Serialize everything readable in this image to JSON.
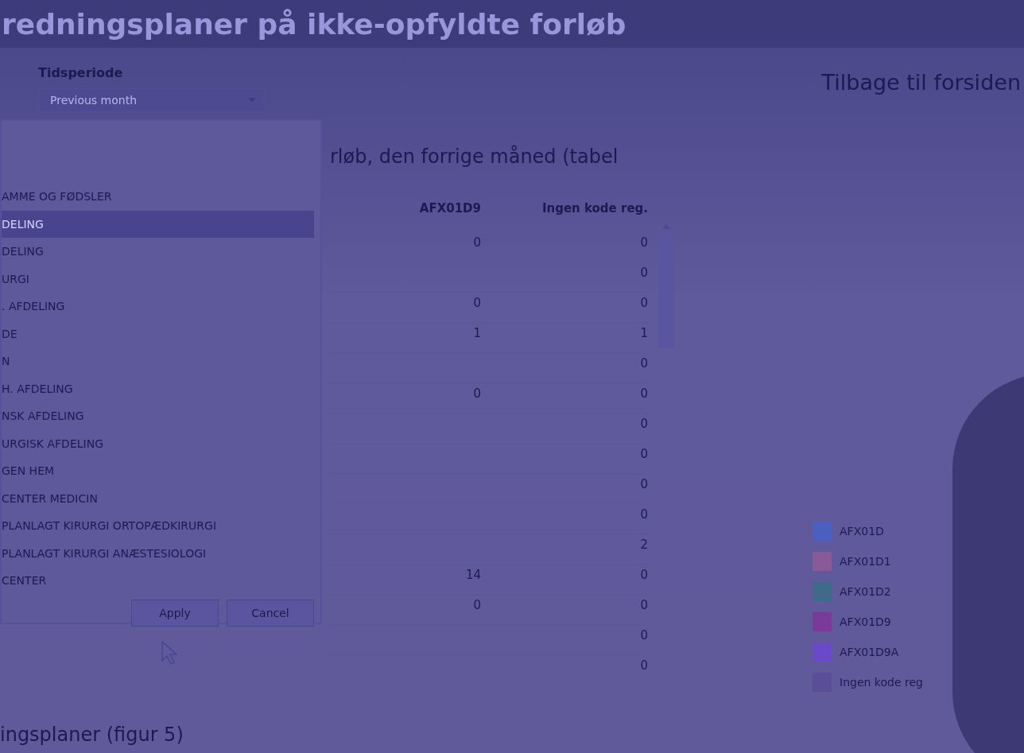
{
  "header": {
    "title": "redningsplaner på ikke-opfyldte forløb"
  },
  "filter": {
    "label": "Tidsperiode",
    "value": "Previous month"
  },
  "back_link": "Tilbage til forsiden",
  "section_heading": "rløb, den forrige måned (tabel",
  "popup": {
    "items": [
      {
        "label": "AMME OG FØDSLER",
        "selected": false
      },
      {
        "label": "DELING",
        "selected": true
      },
      {
        "label": "DELING",
        "selected": false
      },
      {
        "label": "URGI",
        "selected": false
      },
      {
        "label": ". AFDELING",
        "selected": false
      },
      {
        "label": "DE",
        "selected": false
      },
      {
        "label": "N",
        "selected": false
      },
      {
        "label": "H. AFDELING",
        "selected": false
      },
      {
        "label": "NSK AFDELING",
        "selected": false
      },
      {
        "label": "URGISK AFDELING",
        "selected": false
      },
      {
        "label": "GEN HEM",
        "selected": false
      },
      {
        "label": "CENTER MEDICIN",
        "selected": false
      },
      {
        "label": "PLANLAGT KIRURGI ORTOPÆDKIRURGI",
        "selected": false
      },
      {
        "label": "PLANLAGT KIRURGI ANÆSTESIOLOGI",
        "selected": false
      },
      {
        "label": "CENTER",
        "selected": false
      }
    ],
    "buttons": [
      "Apply",
      "Cancel"
    ]
  },
  "table": {
    "columns": [
      "AFX01D9",
      "Ingen kode reg."
    ],
    "rows": [
      [
        "0",
        "0"
      ],
      [
        "",
        "0"
      ],
      [
        "0",
        "0"
      ],
      [
        "1",
        "1"
      ],
      [
        "",
        "0"
      ],
      [
        "0",
        "0"
      ],
      [
        "",
        "0"
      ],
      [
        "",
        "0"
      ],
      [
        "",
        "0"
      ],
      [
        "",
        "0"
      ],
      [
        "",
        "2"
      ],
      [
        "14",
        "0"
      ],
      [
        "0",
        "0"
      ],
      [
        "",
        "0"
      ],
      [
        "",
        "0"
      ]
    ]
  },
  "legend": [
    {
      "label": "AFX01D",
      "color": "#4a5fc0"
    },
    {
      "label": "AFX01D1",
      "color": "#8a5a98"
    },
    {
      "label": "AFX01D2",
      "color": "#3f6a8a"
    },
    {
      "label": "AFX01D9",
      "color": "#7a3a9a"
    },
    {
      "label": "AFX01D9A",
      "color": "#6a4ac8"
    },
    {
      "label": "Ingen kode reg",
      "color": "#5a4e98"
    }
  ],
  "bottom_heading": "ingsplaner (figur 5)"
}
